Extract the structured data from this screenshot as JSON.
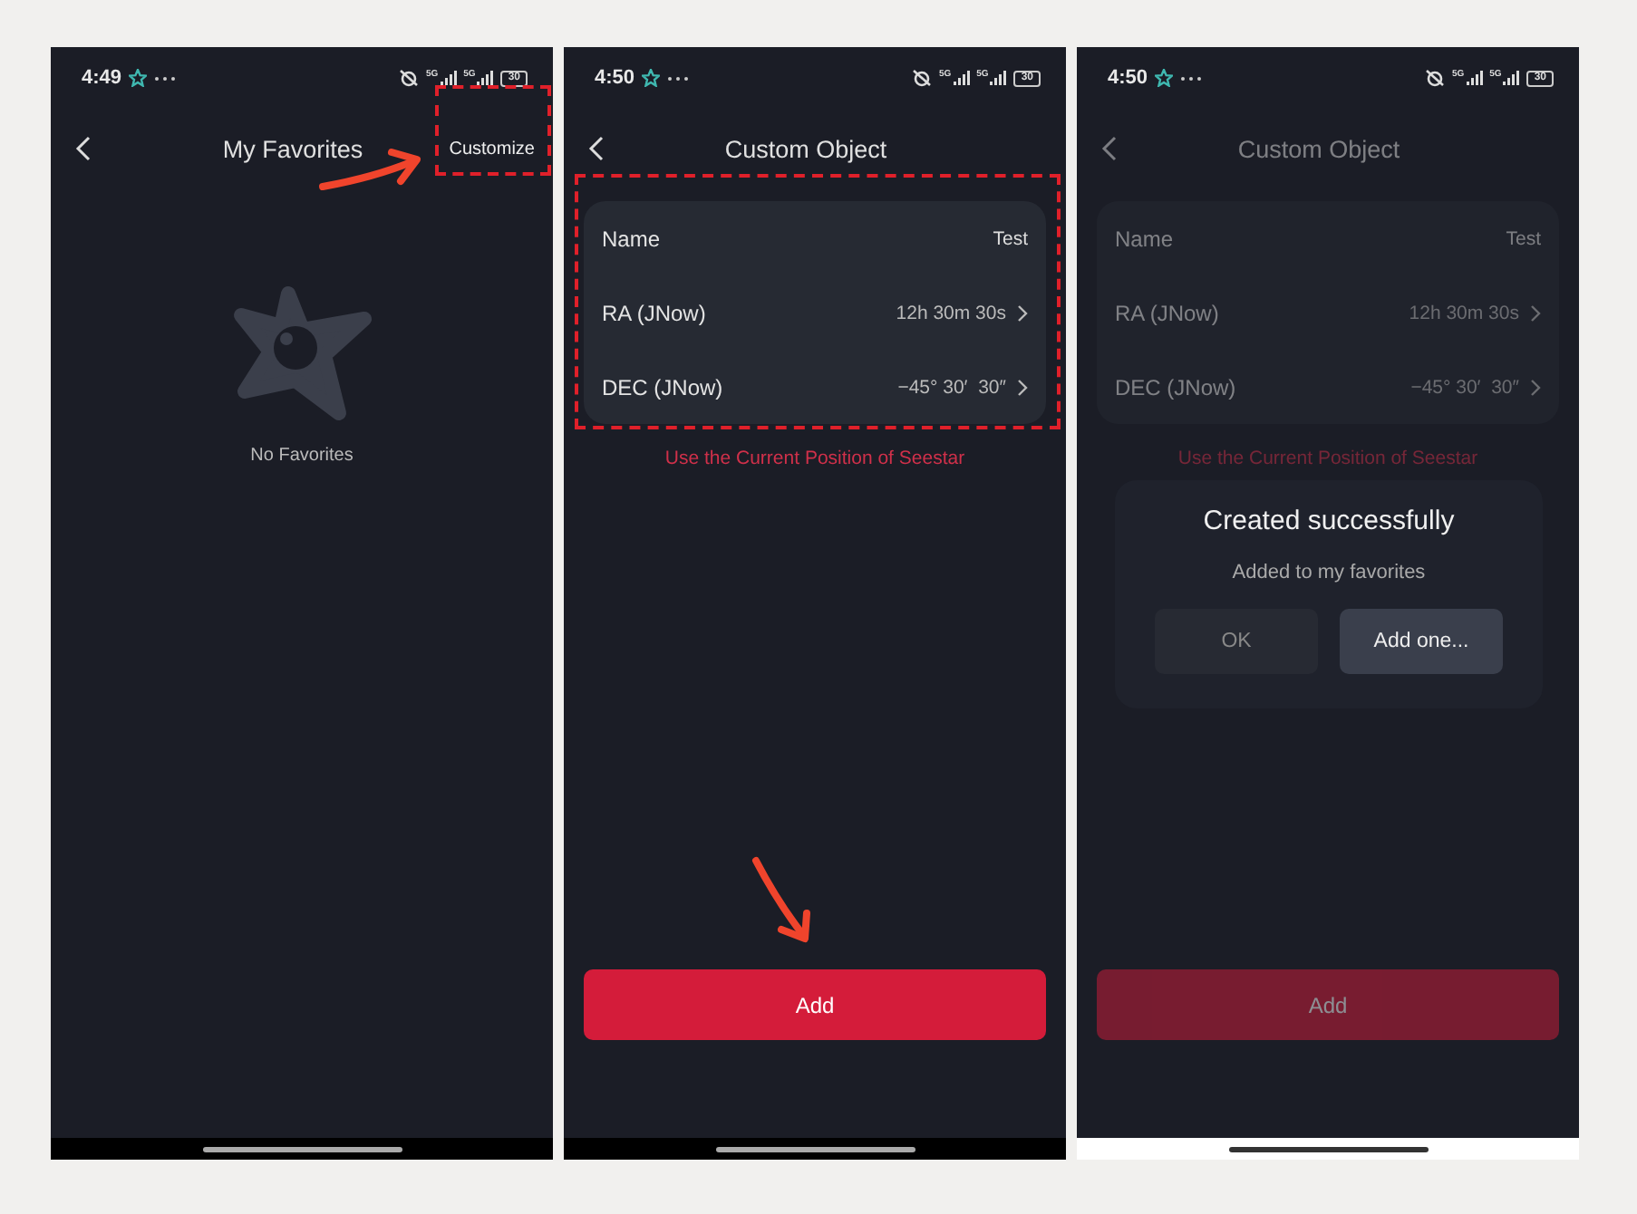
{
  "screens": [
    {
      "kind": "favorites",
      "time": "4:49",
      "signals": [
        "5G",
        "5G"
      ],
      "battery": "30",
      "title": "My Favorites",
      "action": {
        "label": "Customize",
        "highlighted": true
      },
      "annotation_arrow": true,
      "empty_text": "No Favorites",
      "dimmed": false,
      "light_nav_bar": false
    },
    {
      "kind": "form",
      "time": "4:50",
      "signals": [
        "5G",
        "5G"
      ],
      "battery": "30",
      "title": "Custom Object",
      "fields": [
        {
          "label": "Name",
          "value": "Test",
          "has_chevron": false
        },
        {
          "label": "RA (JNow)",
          "value": "12h 30m 30s",
          "has_chevron": true
        },
        {
          "label": "DEC (JNow)",
          "value": "−45° 30′  30″",
          "has_chevron": true
        }
      ],
      "form_highlighted": true,
      "link": "Use the Current Position of Seestar",
      "button": "Add",
      "annotation_arrow": true,
      "dimmed": false,
      "light_nav_bar": false
    },
    {
      "kind": "form",
      "time": "4:50",
      "signals": [
        "5G",
        "5G"
      ],
      "battery": "30",
      "title": "Custom Object",
      "fields": [
        {
          "label": "Name",
          "value": "Test",
          "has_chevron": false
        },
        {
          "label": "RA (JNow)",
          "value": "12h 30m 30s",
          "has_chevron": true
        },
        {
          "label": "DEC (JNow)",
          "value": "−45° 30′  30″",
          "has_chevron": true
        }
      ],
      "form_highlighted": false,
      "link": "Use the Current Position of Seestar",
      "button": "Add",
      "dimmed": true,
      "light_nav_bar": true,
      "dialog": {
        "title": "Created successfully",
        "message": "Added to my favorites",
        "buttons": [
          {
            "label": "OK",
            "primary": false
          },
          {
            "label": "Add one...",
            "primary": true
          }
        ]
      }
    }
  ]
}
